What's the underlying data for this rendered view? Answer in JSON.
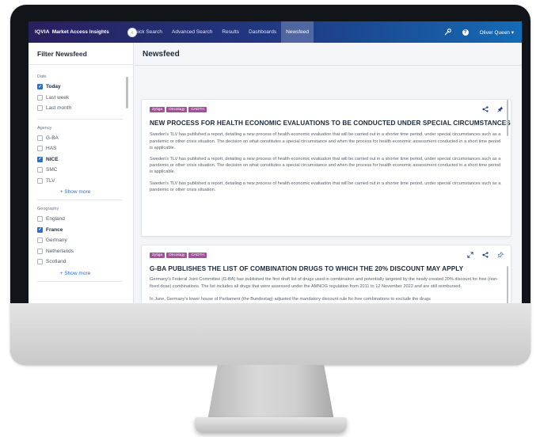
{
  "topbar": {
    "brand_iqvia": "IQVIA",
    "brand_app": "Market Access Insights",
    "nav": [
      "Quick Search",
      "Advanced Search",
      "Results",
      "Dashboards",
      "Newsfeed"
    ],
    "active_nav": "Newsfeed",
    "user_name": "Oliver Queen",
    "user_caret": "▾",
    "help_glyph": "?"
  },
  "sidebar": {
    "title": "Filter Newsfeed",
    "collapse_glyph": "‹",
    "groups": [
      {
        "title": "Date",
        "options": [
          {
            "label": "Today",
            "checked": true
          },
          {
            "label": "Last week",
            "checked": false
          },
          {
            "label": "Last month",
            "checked": false
          }
        ]
      },
      {
        "title": "Agency",
        "options": [
          {
            "label": "G-BA",
            "checked": false
          },
          {
            "label": "HAS",
            "checked": false
          },
          {
            "label": "NICE",
            "checked": true
          },
          {
            "label": "SMC",
            "checked": false
          },
          {
            "label": "TLV",
            "checked": false
          }
        ],
        "show_more": "+ Show more"
      },
      {
        "title": "Geography",
        "options": [
          {
            "label": "England",
            "checked": false
          },
          {
            "label": "France",
            "checked": true
          },
          {
            "label": "Germany",
            "checked": false
          },
          {
            "label": "Netherlands",
            "checked": false
          },
          {
            "label": "Scotland",
            "checked": false
          }
        ],
        "show_more": "+ Show more"
      }
    ]
  },
  "main": {
    "title": "Newsfeed",
    "cards": [
      {
        "tags": [
          "Zytiga",
          "Oncology",
          "CADTH"
        ],
        "title": "NEW PROCESS FOR HEALTH ECONOMIC EVALUATIONS TO BE CONDUCTED UNDER SPECIAL CIRCUMSTANCES",
        "paragraphs": [
          "Sweden's TLV has published a report, detailing a new process of health economic evaluation that will be carried out in a shorter time period, under special circumstances such as a pandemic or other crisis situation. The decision on what constitutes a special circumstance and when the process for health economic assessment conducted in a short time period is applicable.",
          "Sweden's TLV has published a report, detailing a new process of health economic evaluation that will be carried out in a shorter time period, under special circumstances such as a pandemic or other crisis situation. The decision on what constitutes a special circumstance and when the process for health economic assessment conducted in a short time period is applicable.",
          "Sweden's TLV has published a report, detailing a new process of health economic evaluation that will be carried out in a shorter time period, under special circumstances such as a pandemic or other crisis situation."
        ],
        "icons": [
          "share-icon",
          "pin-icon"
        ]
      },
      {
        "tags": [
          "Zytiga",
          "Oncology",
          "CADTH"
        ],
        "title": "G-BA PUBLISHES THE LIST OF COMBINATION DRUGS TO WHICH THE 20% DISCOUNT MAY APPLY",
        "paragraphs": [
          "Germany's Federal Joint Committee (G-BA) has published the first draft list of drugs used in combination and potentially targeted by the newly created 20% discount for free (non-fixed dose) combinations. The list includes all drugs that were assessed under the AMNOG regulation from 2011 to 12 November 2022 and are still reimbursed.",
          "In June, Germany's lower house of Parliament (the Bundestag) adjusted the mandatory discount rule for free combinations to exclude the drugs"
        ],
        "icons": [
          "expand-icon",
          "share-icon",
          "pin-icon"
        ]
      }
    ]
  },
  "colors": {
    "topbar_start": "#2a1f5e",
    "topbar_end": "#146bb5",
    "tag": "#a2509a",
    "accent": "#2a6fc9",
    "pin_active": "#1f3c86"
  }
}
